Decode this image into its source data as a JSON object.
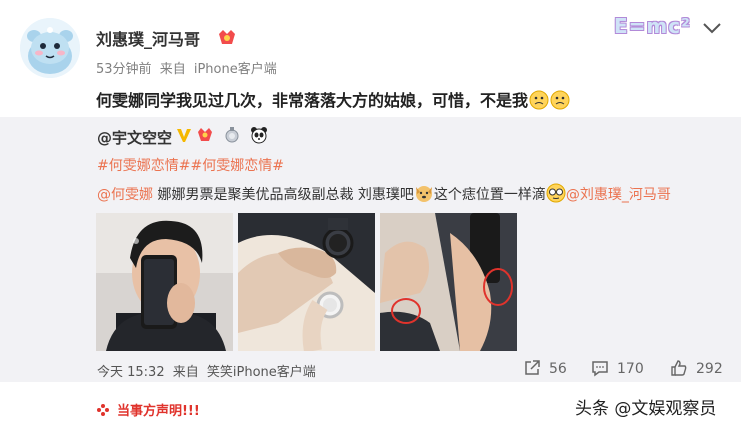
{
  "post": {
    "author": "刘惠璞_河马哥",
    "time": "53分钟前",
    "from_label": "来自",
    "client": "iPhone客户端",
    "text": "何雯娜同学我见过几次，非常落落大方的姑娘，可惜，不是我"
  },
  "header_badge": "E=mc²",
  "repost": {
    "author": "@宇文空空",
    "hashtags": "#何雯娜恋情##何雯娜恋情#",
    "mention": "@何雯娜",
    "text_part1": " 娜娜男票是聚美优品高级副总裁 刘惠璞吧",
    "text_part2": "这个痣位置一样滴",
    "mention2": "@刘惠璞_河马哥",
    "time": "今天 15:32",
    "from_label": "来自",
    "client": "笑笑iPhone客户端",
    "reposts": "56",
    "comments": "170",
    "likes": "292"
  },
  "footer": {
    "statement": "当事方声明!!!",
    "watermark": "头条 @文娱观察员"
  },
  "colors": {
    "link": "#eb7350",
    "repost_bg": "#f2f2f5",
    "statement": "#e0332c",
    "verified": "#f5b800"
  }
}
